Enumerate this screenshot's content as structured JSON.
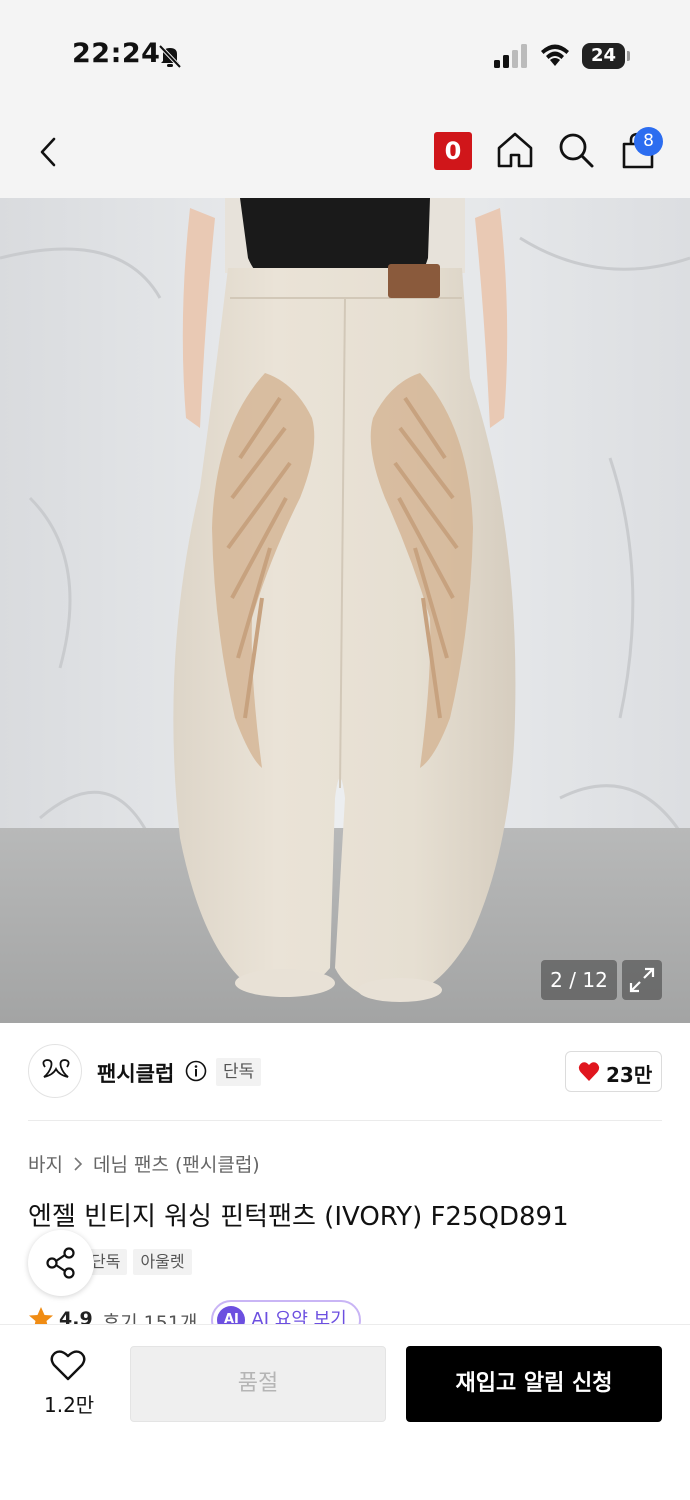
{
  "status_bar": {
    "time": "22:24",
    "battery": "24",
    "icons": [
      "bell-slash-icon",
      "signal-icon",
      "wifi-icon",
      "battery-icon"
    ]
  },
  "nav": {
    "icons": [
      "back-icon",
      "shop-logo-icon",
      "home-icon",
      "search-icon",
      "cart-icon"
    ],
    "shop_logo_text": "0",
    "cart_count": "8"
  },
  "gallery": {
    "counter": "2 / 12",
    "expand_icon": "expand-icon"
  },
  "brand": {
    "name": "팬시클럽",
    "tag": "단독",
    "like_count": "23만",
    "accent_color": "#e0161e"
  },
  "product": {
    "breadcrumb": [
      "바지",
      "데님 팬츠 (팬시클럽)"
    ],
    "title": "엔젤 빈티지 워싱 핀턱팬츠 (IVORY) F25QD891",
    "tags": [
      "단독",
      "아울렛"
    ],
    "rating": "4.9",
    "reviews": "후기 151개",
    "ai_badge": "AI",
    "ai_label": "AI 요약 보기"
  },
  "bottom_bar": {
    "wish_count": "1.2만",
    "soldout_label": "품절",
    "restock_label": "재입고 알림 신청"
  }
}
